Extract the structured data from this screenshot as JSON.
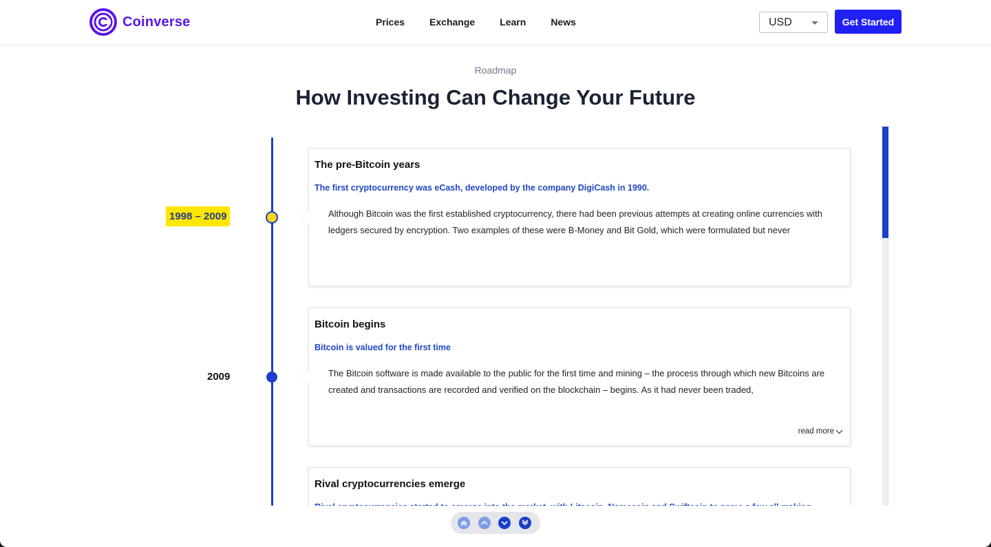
{
  "header": {
    "brand": "Coinverse",
    "nav": [
      "Prices",
      "Exchange",
      "Learn",
      "News"
    ],
    "currency": "USD",
    "cta": "Get Started"
  },
  "section": {
    "eyebrow": "Roadmap",
    "title": "How Investing Can Change Your Future"
  },
  "timeline": [
    {
      "date": "1998 – 2009",
      "title": "The pre-Bitcoin years",
      "subtitle": "The first cryptocurrency was eCash, developed by the company DigiCash in 1990.",
      "body": "Although Bitcoin was the first established cryptocurrency, there had been previous attempts at creating online currencies with ledgers secured by encryption. Two examples of these were B-Money and Bit Gold, which were formulated but never",
      "active": true
    },
    {
      "date": "2009",
      "title": "Bitcoin begins",
      "subtitle": "Bitcoin is valued for the first time",
      "body": "The Bitcoin software is made available to the public for the first time and mining – the process through which new Bitcoins are created and transactions are recorded and verified on the blockchain – begins. As it had never been traded,",
      "read_more": "read more",
      "active": false
    },
    {
      "title": "Rival cryptocurrencies emerge",
      "subtitle": "Rival cryptocurrencies started to emerge into the market, with Litecoin, Namecoin and Swiftcoin to name a few all making"
    }
  ],
  "colors": {
    "brand": "#5a16e6",
    "cta": "#2020f5",
    "timeline": "#1b3fc9",
    "highlight": "#ffe600",
    "link": "#1f47c4"
  },
  "icons": {
    "pill_buttons": [
      "double-chevron-up-icon",
      "chevron-up-icon",
      "chevron-down-icon",
      "double-chevron-down-icon"
    ]
  }
}
